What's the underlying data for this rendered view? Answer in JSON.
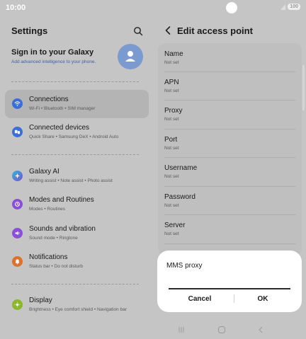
{
  "status": {
    "time": "10:00",
    "battery": "100"
  },
  "left": {
    "title": "Settings",
    "account": {
      "title": "Sign in to your Galaxy",
      "subtitle": "Add advanced intelligence to your phone."
    },
    "items": [
      {
        "label": "Connections",
        "sub": "Wi-Fi  •  Bluetooth  •  SIM manager",
        "icon": "wifi-icon",
        "color": "#3a6fd8"
      },
      {
        "label": "Connected devices",
        "sub": "Quick Share  •  Samsung DeX  •  Android Auto",
        "icon": "connected-devices-icon",
        "color": "#3a6fd8"
      },
      {
        "label": "Galaxy AI",
        "sub": "Writing assist  •  Note assist  •  Photo assist",
        "icon": "galaxy-ai-icon",
        "color": "#2f8fd8"
      },
      {
        "label": "Modes and Routines",
        "sub": "Modes  •  Routines",
        "icon": "modes-icon",
        "color": "#8a4fd8"
      },
      {
        "label": "Sounds and vibration",
        "sub": "Sound mode  •  Ringtone",
        "icon": "sound-icon",
        "color": "#8a4fd8"
      },
      {
        "label": "Notifications",
        "sub": "Status bar  •  Do not disturb",
        "icon": "notification-icon",
        "color": "#e0702a"
      },
      {
        "label": "Display",
        "sub": "Brightness  •  Eye comfort shield  •  Navigation bar",
        "icon": "display-icon",
        "color": "#8ab82a"
      }
    ]
  },
  "right": {
    "title": "Edit access point",
    "fields": [
      {
        "label": "Name",
        "value": "Not set"
      },
      {
        "label": "APN",
        "value": "Not set"
      },
      {
        "label": "Proxy",
        "value": "Not set"
      },
      {
        "label": "Port",
        "value": "Not set"
      },
      {
        "label": "Username",
        "value": "Not set"
      },
      {
        "label": "Password",
        "value": "Not set"
      },
      {
        "label": "Server",
        "value": "Not set"
      }
    ]
  },
  "dialog": {
    "title": "MMS proxy",
    "input_value": "",
    "cancel": "Cancel",
    "ok": "OK"
  }
}
